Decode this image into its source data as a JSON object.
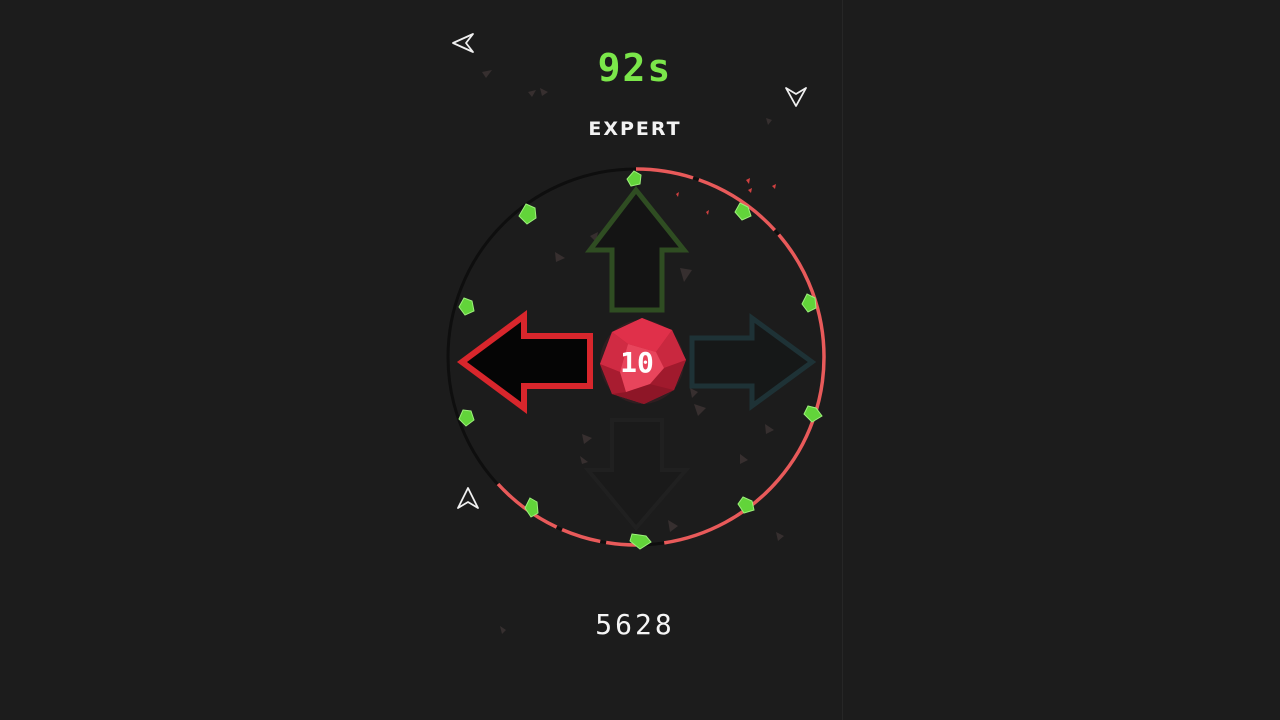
{
  "hud": {
    "timer": "92s",
    "difficulty": "EXPERT",
    "score": "5628"
  },
  "core": {
    "count": "10"
  },
  "colors": {
    "background": "#1c1c1c",
    "timer": "#7be64a",
    "ring": "#e85a5a",
    "active_arrow": "#d8262c",
    "up_arrow": "#2f4d22",
    "right_arrow": "#1e3236",
    "gem": "#62d43a",
    "core": "#e0304a"
  },
  "arrows": [
    {
      "direction": "left",
      "state": "active"
    },
    {
      "direction": "up",
      "state": "dim"
    },
    {
      "direction": "right",
      "state": "dim"
    },
    {
      "direction": "down",
      "state": "hidden"
    }
  ]
}
